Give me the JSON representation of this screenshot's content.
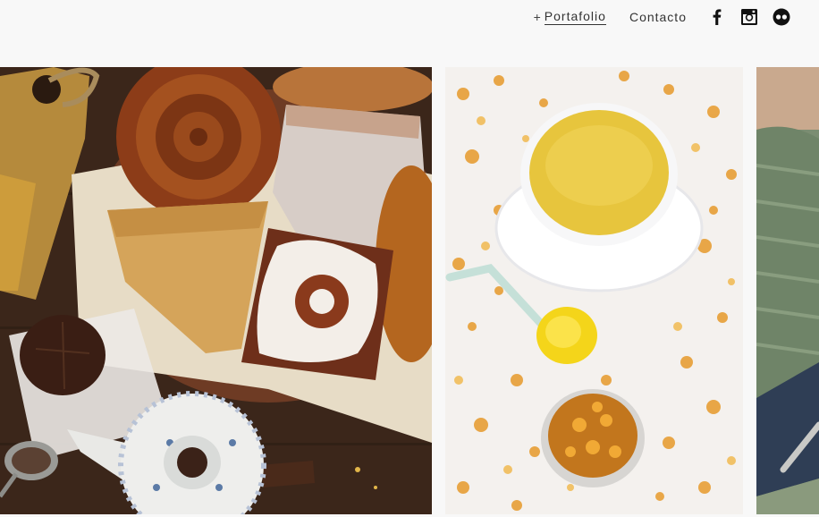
{
  "nav": {
    "plus": "+",
    "portfolio": "Portafolio",
    "contact": "Contacto"
  },
  "social": [
    {
      "icon": "facebook-icon"
    },
    {
      "icon": "instagram-icon"
    },
    {
      "icon": "flickr-icon"
    }
  ],
  "gallery": {
    "photos": [
      {
        "subject": "pastries-and-teapot-photo"
      },
      {
        "subject": "calendula-tea-photo"
      },
      {
        "subject": "woven-basket-photo"
      }
    ]
  },
  "colors": {
    "background": "#f8f8f8",
    "text": "#333333",
    "icon": "#111111"
  }
}
